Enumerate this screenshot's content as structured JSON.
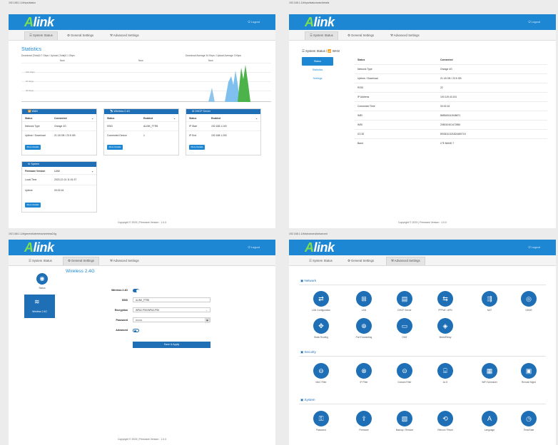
{
  "brand": {
    "logo_a": "A",
    "logo_rest": "link",
    "logout": "⏻ Logout"
  },
  "tabs": {
    "status": "☰ System Status",
    "general": "⚙ General Settings",
    "advanced": "⚒ Advanced Settings"
  },
  "footer": "Copyright © 2023 | Firmware Version : 1.0.0",
  "captions": {
    "p1": "192.168.1.1/#/sys/status",
    "p2": "192.168.1.1/#/sys/status/wan/details",
    "p3": "192.168.1.1/#/general/wireless/wireless24g",
    "p4": "192.168.1.1/#/advanced/advanced"
  },
  "stats": {
    "title": "Statistics",
    "left_sub": "Download (Total)0.7 Gbps / Upload (Total)0.1 Gbps",
    "right_sub": "Download Average 34 Kbps / Upload Average 3 Kbps",
    "y_ticks": [
      "100 Kbps",
      "67 Kbps",
      "33 Kbps",
      ""
    ],
    "col_labels": [
      "Now",
      "Now",
      "Now"
    ]
  },
  "wan_card": {
    "title": "📶 WAN",
    "head": [
      "Status",
      "Connected"
    ],
    "rows": [
      [
        "Network Type",
        "Orange 4G"
      ],
      [
        "Uptime / Download",
        "21.18 GB / 23.5 GB"
      ]
    ],
    "button": "More Details"
  },
  "wireless_card": {
    "title": "📡 Wireless 2.4G",
    "head": [
      "Status",
      "Enabled"
    ],
    "rows": [
      [
        "SSID",
        "ALINK_FTR8"
      ],
      [
        "Connected Device",
        "1"
      ]
    ],
    "button": "More Details"
  },
  "dhcp_card": {
    "title": "⚙ DHCP Server",
    "head": [
      "Status",
      "Enabled"
    ],
    "rows": [
      [
        "IP Start",
        "192.168.1.100"
      ],
      [
        "IP End",
        "192.168.1.200"
      ]
    ],
    "button": "More Details"
  },
  "system_card": {
    "title": "⚙ System",
    "head": [
      "Firmware Version",
      "1.0.0"
    ],
    "rows": [
      [
        "Local Time",
        "2023-12-01 11:01:37"
      ],
      [
        "Uptime",
        "00:02:16"
      ]
    ],
    "button": "More Details"
  },
  "wan_details": {
    "crumb": "☰ System Status  /  📶 WAN",
    "side": [
      "Status",
      "Statistics",
      "Settings"
    ],
    "head": [
      "Status",
      "Connected"
    ],
    "rows": [
      [
        "Network Type",
        "Orange 4G"
      ],
      [
        "Uptime / Download",
        "21.18 GB / 23.5 GB"
      ],
      [
        "RSSI",
        "22"
      ],
      [
        "IP Address",
        "100.119.43.151"
      ],
      [
        "Connected Time",
        "00:02:16"
      ],
      [
        "IMEI",
        "865543041948671"
      ],
      [
        "IMSI",
        "208010401472850"
      ],
      [
        "ICCID",
        "8933011321824480715"
      ],
      [
        "Band",
        "LTE BAND 7"
      ]
    ]
  },
  "wireless": {
    "title": "Wireless 2.4G",
    "side": [
      "Status",
      "Wireless 2.4G"
    ],
    "labels": [
      "Wireless 2.4G",
      "SSID",
      "Encryption",
      "Password",
      "Advanced"
    ],
    "ssid": "ALINK_FTR8",
    "encryption": "WPA2-PSK/WPA3-PSK",
    "password": "••••••••",
    "apply": "Save & Apply"
  },
  "advanced": {
    "sections": [
      "▣ Network",
      "▣ Security",
      "▣ System"
    ],
    "network": [
      "LAN Configuration",
      "LAN",
      "DHCP Server",
      "PPPoE / APN",
      "NAT",
      "DDNS",
      "Static Routing",
      "Port Forwarding",
      "DMZ",
      "Mesh/Relay"
    ],
    "security": [
      "MAC Filter",
      "IP Filter",
      "Domain Filter",
      "ALG",
      "WiFi Scheduler",
      "Remote Mgmt"
    ],
    "system": [
      "Password",
      "Firmware",
      "Backup / Restore",
      "Reboot / Reset",
      "Language",
      "Time/Date"
    ]
  }
}
